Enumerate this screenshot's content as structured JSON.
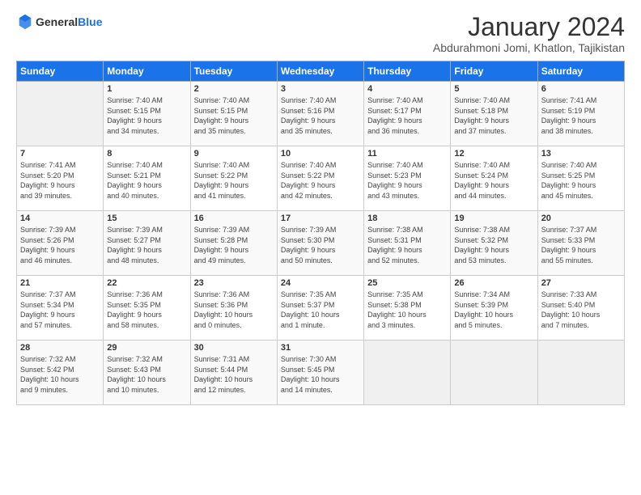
{
  "logo": {
    "general": "General",
    "blue": "Blue"
  },
  "header": {
    "month": "January 2024",
    "location": "Abdurahmoni Jomi, Khatlon, Tajikistan"
  },
  "days_of_week": [
    "Sunday",
    "Monday",
    "Tuesday",
    "Wednesday",
    "Thursday",
    "Friday",
    "Saturday"
  ],
  "weeks": [
    [
      {
        "day": "",
        "content": ""
      },
      {
        "day": "1",
        "content": "Sunrise: 7:40 AM\nSunset: 5:15 PM\nDaylight: 9 hours\nand 34 minutes."
      },
      {
        "day": "2",
        "content": "Sunrise: 7:40 AM\nSunset: 5:15 PM\nDaylight: 9 hours\nand 35 minutes."
      },
      {
        "day": "3",
        "content": "Sunrise: 7:40 AM\nSunset: 5:16 PM\nDaylight: 9 hours\nand 35 minutes."
      },
      {
        "day": "4",
        "content": "Sunrise: 7:40 AM\nSunset: 5:17 PM\nDaylight: 9 hours\nand 36 minutes."
      },
      {
        "day": "5",
        "content": "Sunrise: 7:40 AM\nSunset: 5:18 PM\nDaylight: 9 hours\nand 37 minutes."
      },
      {
        "day": "6",
        "content": "Sunrise: 7:41 AM\nSunset: 5:19 PM\nDaylight: 9 hours\nand 38 minutes."
      }
    ],
    [
      {
        "day": "7",
        "content": "Sunrise: 7:41 AM\nSunset: 5:20 PM\nDaylight: 9 hours\nand 39 minutes."
      },
      {
        "day": "8",
        "content": "Sunrise: 7:40 AM\nSunset: 5:21 PM\nDaylight: 9 hours\nand 40 minutes."
      },
      {
        "day": "9",
        "content": "Sunrise: 7:40 AM\nSunset: 5:22 PM\nDaylight: 9 hours\nand 41 minutes."
      },
      {
        "day": "10",
        "content": "Sunrise: 7:40 AM\nSunset: 5:22 PM\nDaylight: 9 hours\nand 42 minutes."
      },
      {
        "day": "11",
        "content": "Sunrise: 7:40 AM\nSunset: 5:23 PM\nDaylight: 9 hours\nand 43 minutes."
      },
      {
        "day": "12",
        "content": "Sunrise: 7:40 AM\nSunset: 5:24 PM\nDaylight: 9 hours\nand 44 minutes."
      },
      {
        "day": "13",
        "content": "Sunrise: 7:40 AM\nSunset: 5:25 PM\nDaylight: 9 hours\nand 45 minutes."
      }
    ],
    [
      {
        "day": "14",
        "content": "Sunrise: 7:39 AM\nSunset: 5:26 PM\nDaylight: 9 hours\nand 46 minutes."
      },
      {
        "day": "15",
        "content": "Sunrise: 7:39 AM\nSunset: 5:27 PM\nDaylight: 9 hours\nand 48 minutes."
      },
      {
        "day": "16",
        "content": "Sunrise: 7:39 AM\nSunset: 5:28 PM\nDaylight: 9 hours\nand 49 minutes."
      },
      {
        "day": "17",
        "content": "Sunrise: 7:39 AM\nSunset: 5:30 PM\nDaylight: 9 hours\nand 50 minutes."
      },
      {
        "day": "18",
        "content": "Sunrise: 7:38 AM\nSunset: 5:31 PM\nDaylight: 9 hours\nand 52 minutes."
      },
      {
        "day": "19",
        "content": "Sunrise: 7:38 AM\nSunset: 5:32 PM\nDaylight: 9 hours\nand 53 minutes."
      },
      {
        "day": "20",
        "content": "Sunrise: 7:37 AM\nSunset: 5:33 PM\nDaylight: 9 hours\nand 55 minutes."
      }
    ],
    [
      {
        "day": "21",
        "content": "Sunrise: 7:37 AM\nSunset: 5:34 PM\nDaylight: 9 hours\nand 57 minutes."
      },
      {
        "day": "22",
        "content": "Sunrise: 7:36 AM\nSunset: 5:35 PM\nDaylight: 9 hours\nand 58 minutes."
      },
      {
        "day": "23",
        "content": "Sunrise: 7:36 AM\nSunset: 5:36 PM\nDaylight: 10 hours\nand 0 minutes."
      },
      {
        "day": "24",
        "content": "Sunrise: 7:35 AM\nSunset: 5:37 PM\nDaylight: 10 hours\nand 1 minute."
      },
      {
        "day": "25",
        "content": "Sunrise: 7:35 AM\nSunset: 5:38 PM\nDaylight: 10 hours\nand 3 minutes."
      },
      {
        "day": "26",
        "content": "Sunrise: 7:34 AM\nSunset: 5:39 PM\nDaylight: 10 hours\nand 5 minutes."
      },
      {
        "day": "27",
        "content": "Sunrise: 7:33 AM\nSunset: 5:40 PM\nDaylight: 10 hours\nand 7 minutes."
      }
    ],
    [
      {
        "day": "28",
        "content": "Sunrise: 7:32 AM\nSunset: 5:42 PM\nDaylight: 10 hours\nand 9 minutes."
      },
      {
        "day": "29",
        "content": "Sunrise: 7:32 AM\nSunset: 5:43 PM\nDaylight: 10 hours\nand 10 minutes."
      },
      {
        "day": "30",
        "content": "Sunrise: 7:31 AM\nSunset: 5:44 PM\nDaylight: 10 hours\nand 12 minutes."
      },
      {
        "day": "31",
        "content": "Sunrise: 7:30 AM\nSunset: 5:45 PM\nDaylight: 10 hours\nand 14 minutes."
      },
      {
        "day": "",
        "content": ""
      },
      {
        "day": "",
        "content": ""
      },
      {
        "day": "",
        "content": ""
      }
    ]
  ]
}
